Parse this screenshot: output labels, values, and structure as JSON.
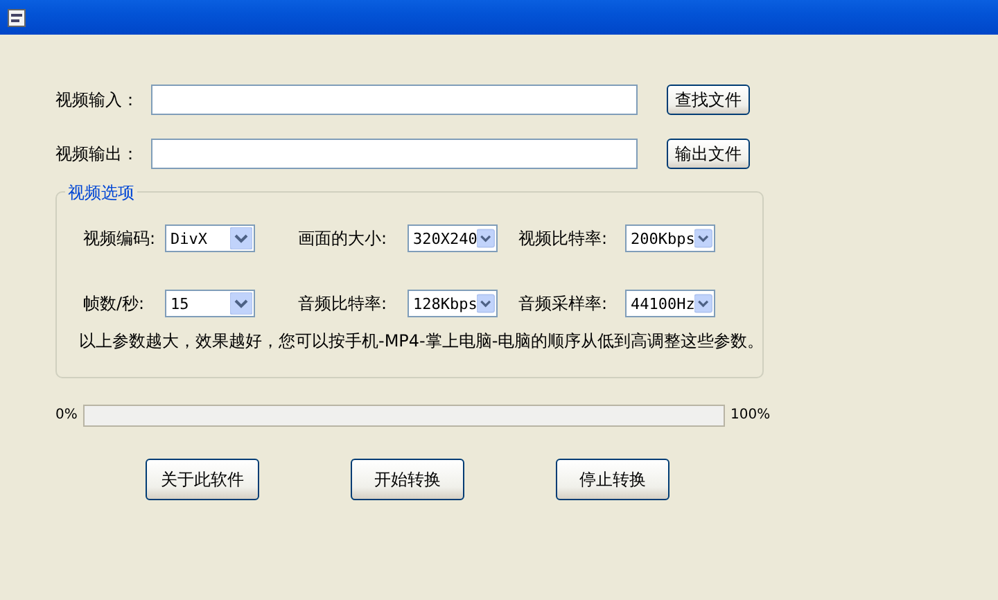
{
  "fields": [
    {
      "label": "视频输入：",
      "button": "查找文件"
    },
    {
      "label": "视频输出：",
      "button": "输出文件"
    }
  ],
  "options": {
    "title": "视频选项",
    "rows": [
      [
        {
          "label": "视频编码:",
          "value": "DivX"
        },
        {
          "label": "画面的大小:",
          "value": "320X240"
        },
        {
          "label": "视频比特率:",
          "value": "200Kbps"
        }
      ],
      [
        {
          "label": "帧数/秒:",
          "value": "15"
        },
        {
          "label": "音频比特率:",
          "value": "128Kbps"
        },
        {
          "label": "音频采样率:",
          "value": "44100Hz"
        }
      ]
    ],
    "note": "以上参数越大，效果越好，您可以按手机-MP4-掌上电脑-电脑的顺序从低到高调整这些参数。"
  },
  "progress": {
    "min_label": "0%",
    "max_label": "100%",
    "level": 0
  },
  "buttons": [
    "关于此软件",
    "开始转换",
    "停止转换"
  ]
}
